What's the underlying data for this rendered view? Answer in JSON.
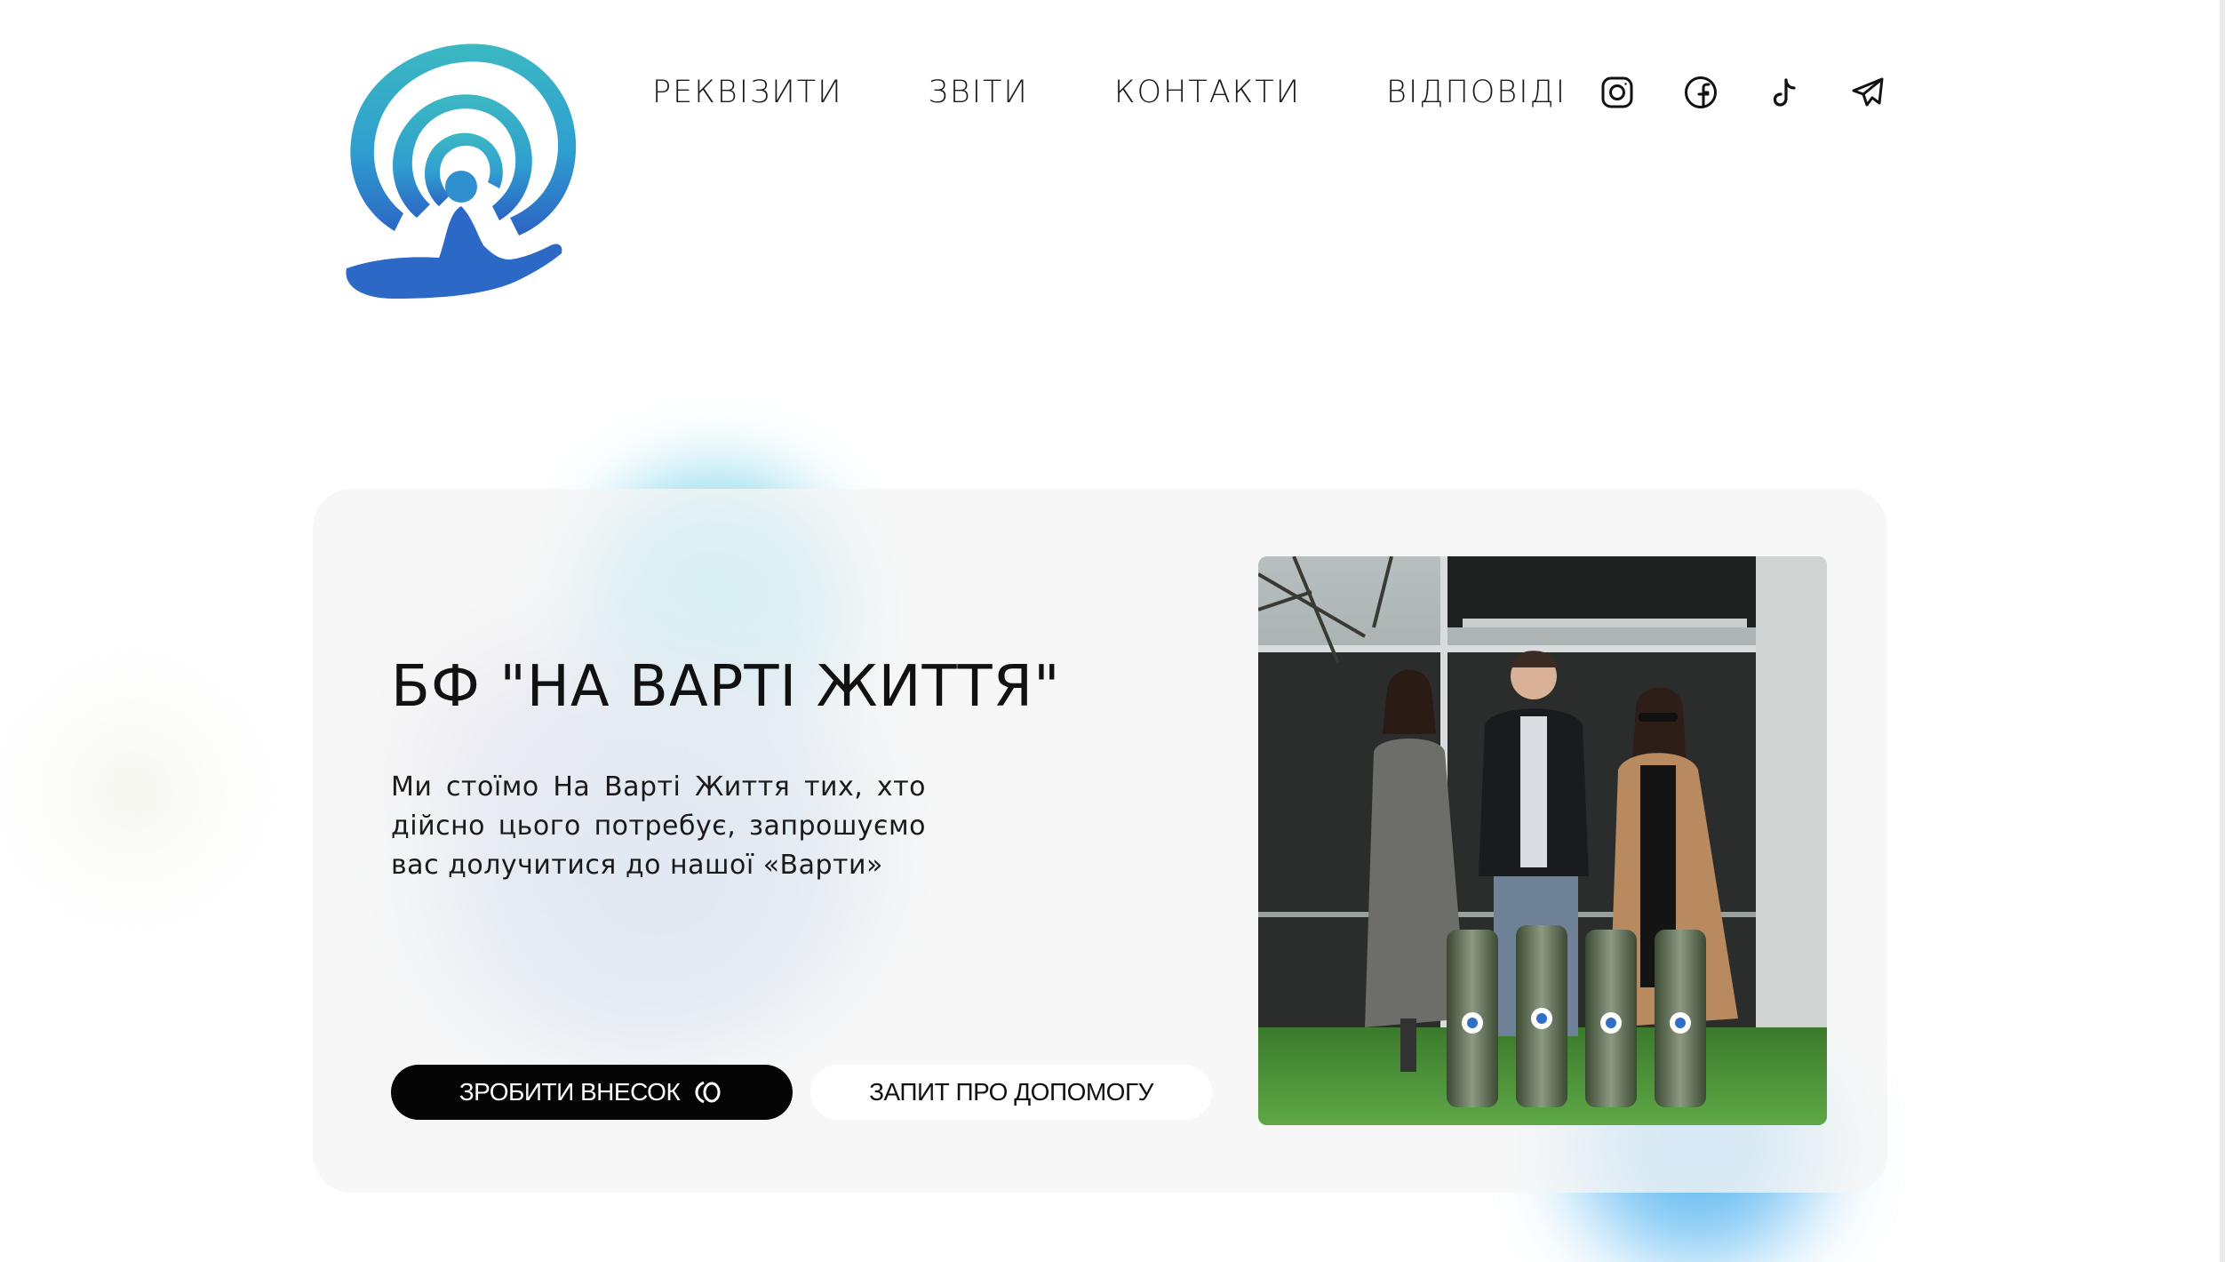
{
  "nav": {
    "items": [
      {
        "label": "РЕКВІЗИТИ"
      },
      {
        "label": "ЗВІТИ"
      },
      {
        "label": "КОНТАКТИ"
      },
      {
        "label": "ВІДПОВІДІ"
      }
    ]
  },
  "socials": [
    {
      "icon": "instagram-icon"
    },
    {
      "icon": "facebook-icon"
    },
    {
      "icon": "tiktok-icon"
    },
    {
      "icon": "telegram-icon"
    }
  ],
  "hero": {
    "title": "БФ \"НА ВАРТІ ЖИТТЯ\"",
    "text": "Ми стоїмо На Варті Життя тих, хто дійсно цього потребує, запрошуємо вас долучитися до нашої «Варти»",
    "primary_button": "ЗРОБИТИ ВНЕСОК",
    "secondary_button": "ЗАПИТ ПРО ДОПОМОГУ"
  },
  "colors": {
    "logo_teal": "#3fb6c4",
    "logo_blue": "#2f6fc6",
    "button_dark": "#050505",
    "card_bg": "#f5f5f5"
  }
}
